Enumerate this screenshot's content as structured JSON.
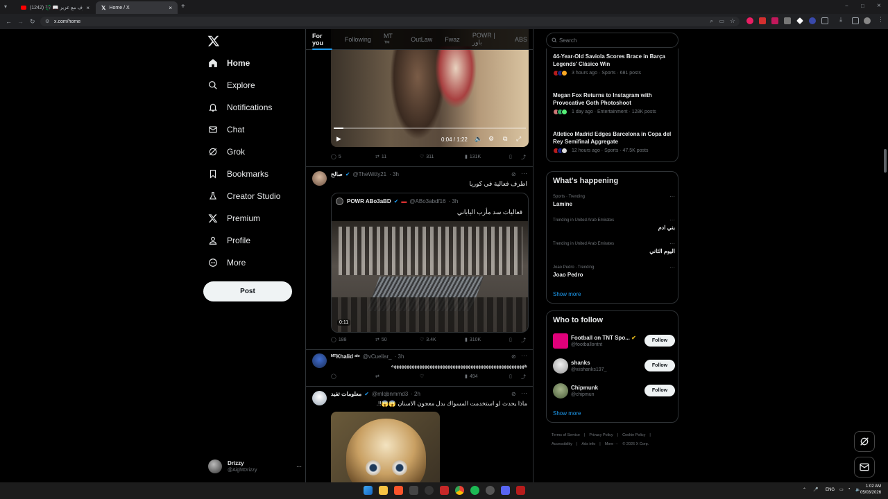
{
  "browser": {
    "tabs": [
      {
        "title": "حروف مع عزيز 📖 💱 (1242)",
        "active": false
      },
      {
        "title": "Home / X",
        "active": true
      }
    ],
    "new_tab": "+",
    "url": "x.com/home",
    "window_min": "−",
    "window_max": "□",
    "window_close": "×"
  },
  "sidebar": {
    "items": [
      {
        "label": "Home",
        "icon": "home-icon"
      },
      {
        "label": "Explore",
        "icon": "search-icon"
      },
      {
        "label": "Notifications",
        "icon": "bell-icon"
      },
      {
        "label": "Chat",
        "icon": "mail-icon"
      },
      {
        "label": "Grok",
        "icon": "grok-icon"
      },
      {
        "label": "Bookmarks",
        "icon": "bookmark-icon"
      },
      {
        "label": "Creator Studio",
        "icon": "creator-icon"
      },
      {
        "label": "Premium",
        "icon": "x-icon"
      },
      {
        "label": "Profile",
        "icon": "person-icon"
      },
      {
        "label": "More",
        "icon": "more-circle-icon"
      }
    ],
    "post_label": "Post",
    "user": {
      "name": "Drizzy",
      "handle": "@AightDrizzy",
      "more": "···"
    }
  },
  "feed": {
    "tabs": [
      "For you",
      "Following",
      "MT ™",
      "OutLaw",
      "Fwaz",
      "POWR | باور",
      "ABS"
    ],
    "active_tab": "For you",
    "video1": {
      "time": "0:04 / 1:22",
      "progress": 0.05
    },
    "post1_actions": {
      "replies": "5",
      "reposts": "11",
      "likes": "311",
      "views": "131K"
    },
    "post2": {
      "name": "صالح",
      "handle": "@TheWitty21",
      "time": "· 3h",
      "text": "اطرف فعالية في كوريا",
      "quote": {
        "name": "POWR ABo3aBD",
        "handle": "@ABo3abdf16",
        "time": "· 3h",
        "text": "فعاليات سد مأرب الياباني",
        "duration": "0:11"
      },
      "actions": {
        "replies": "188",
        "reposts": "50",
        "likes": "3.4K",
        "views": "310K"
      }
    },
    "post3": {
      "name": "ᴹᵀKhalid ᵃˡᵒ",
      "handle": "@vCuellar_",
      "time": "· 3h",
      "text": "ههههههههههههههههههههههههههههههههههههههههههههههههههههه",
      "actions": {
        "replies": "",
        "reposts": "",
        "likes": "",
        "views": "494"
      }
    },
    "post4": {
      "name": "معلومات تفيد",
      "handle": "@mlqbnmmd3",
      "time": "· 2h",
      "text": "ماذا يحدث لو استخدمت المسواك بدل معجون الاسنان 😱😱!!."
    }
  },
  "right": {
    "search_placeholder": "Search",
    "news": [
      {
        "title": "44-Year-Old Saviola Scores Brace in Barça Legends' Clásico Win",
        "meta": "3 hours ago · Sports · 681 posts"
      },
      {
        "title": "Megan Fox Returns to Instagram with Provocative Goth Photoshoot",
        "meta": "1 day ago · Entertainment · 128K posts"
      },
      {
        "title": "Atletico Madrid Edges Barcelona in Copa del Rey Semifinal Aggregate",
        "meta": "12 hours ago · Sports · 47.5K posts"
      }
    ],
    "happening": {
      "title": "What's happening",
      "trends": [
        {
          "context": "Sports · Trending",
          "name": "Lamine"
        },
        {
          "context": "Trending in United Arab Emirates",
          "name": "بني ادم"
        },
        {
          "context": "Trending in United Arab Emirates",
          "name": "اليوم الثاني"
        },
        {
          "context": "Joao Pedro · Trending",
          "name": "Joao Pedro"
        }
      ],
      "show_more": "Show more"
    },
    "who_to_follow": {
      "title": "Who to follow",
      "accounts": [
        {
          "name": "Football on TNT Spo...",
          "handle": "@footballontnt",
          "button": "Follow"
        },
        {
          "name": "shanks",
          "handle": "@xiishanks197_",
          "button": "Follow"
        },
        {
          "name": "Chipmunk",
          "handle": "@chipmun",
          "button": "Follow"
        }
      ],
      "show_more": "Show more"
    },
    "footer": [
      "Terms of Service",
      "|",
      "Privacy Policy",
      "|",
      "Cookie Policy",
      "|",
      "Accessibility",
      "|",
      "Ads info",
      "|",
      "More ···",
      "© 2026 X Corp."
    ]
  },
  "taskbar": {
    "lang": "ENG",
    "time": "1:02 AM",
    "date": "05/03/2026"
  },
  "colors": {
    "accent": "#1d9bf0",
    "background": "#000000",
    "border": "#2f3336"
  }
}
